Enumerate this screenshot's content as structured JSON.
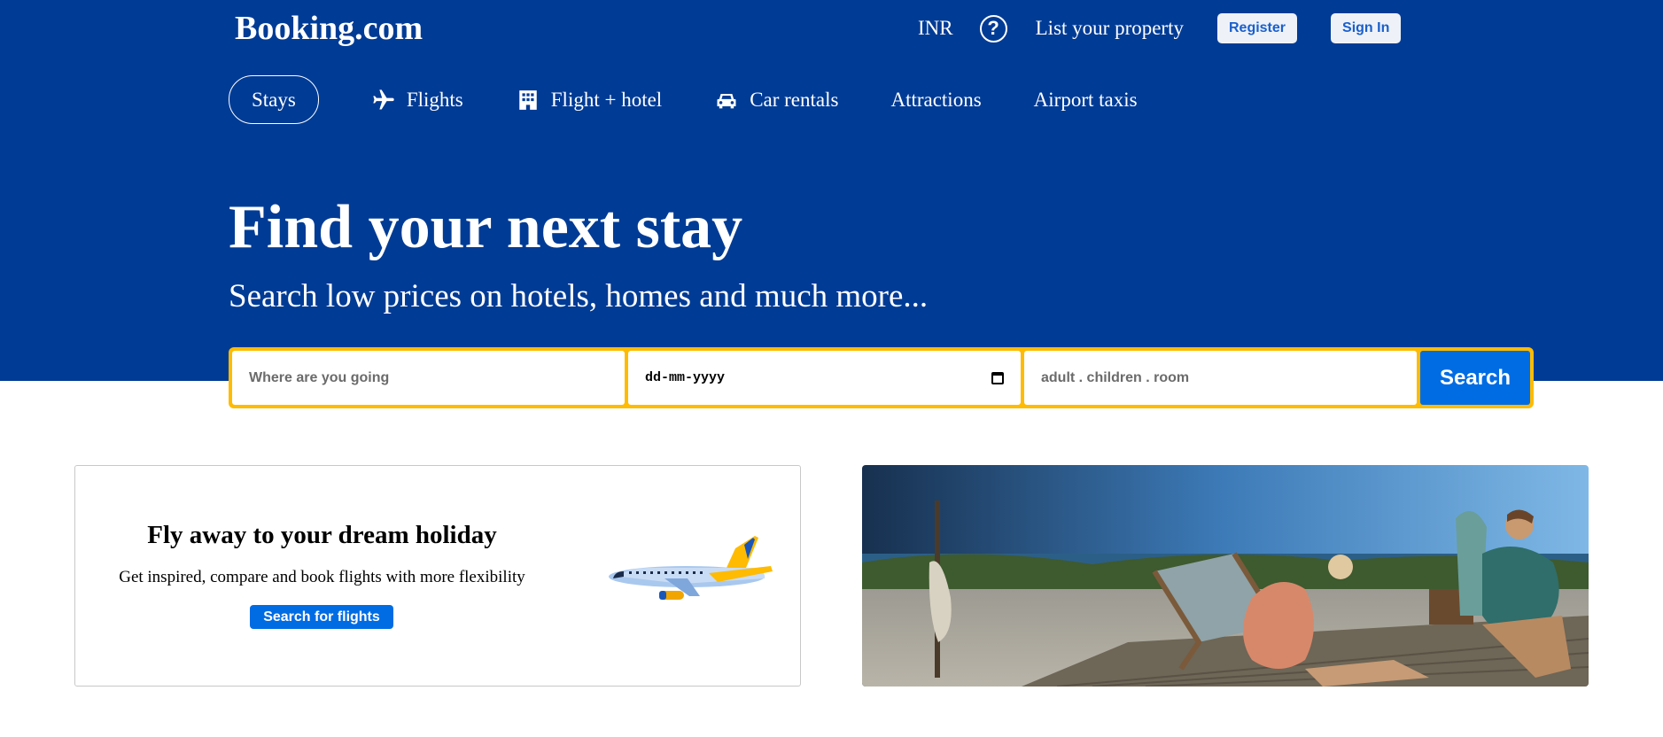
{
  "header": {
    "logo": "Booking.com",
    "currency": "INR",
    "list_property": "List your property",
    "register": "Register",
    "sign_in": "Sign In"
  },
  "nav": {
    "items": [
      {
        "label": "Stays",
        "active": true
      },
      {
        "label": "Flights",
        "icon": "airplane-icon"
      },
      {
        "label": "Flight + hotel",
        "icon": "hotel-icon"
      },
      {
        "label": "Car rentals",
        "icon": "car-icon"
      },
      {
        "label": "Attractions"
      },
      {
        "label": "Airport taxis"
      }
    ]
  },
  "hero": {
    "title": "Find your next stay",
    "subtitle": "Search low prices on hotels, homes and much more..."
  },
  "search": {
    "destination_placeholder": "Where are you going",
    "date_value": "dd-mm-yyyy",
    "guests_placeholder": "adult . children . room",
    "button": "Search"
  },
  "promo": {
    "title": "Fly away to your dream holiday",
    "subtitle": "Get inspired, compare and book flights with more flexibility",
    "button": "Search for flights"
  },
  "colors": {
    "brand_blue": "#003b95",
    "accent_yellow": "#febb02",
    "button_blue": "#006ce4"
  }
}
